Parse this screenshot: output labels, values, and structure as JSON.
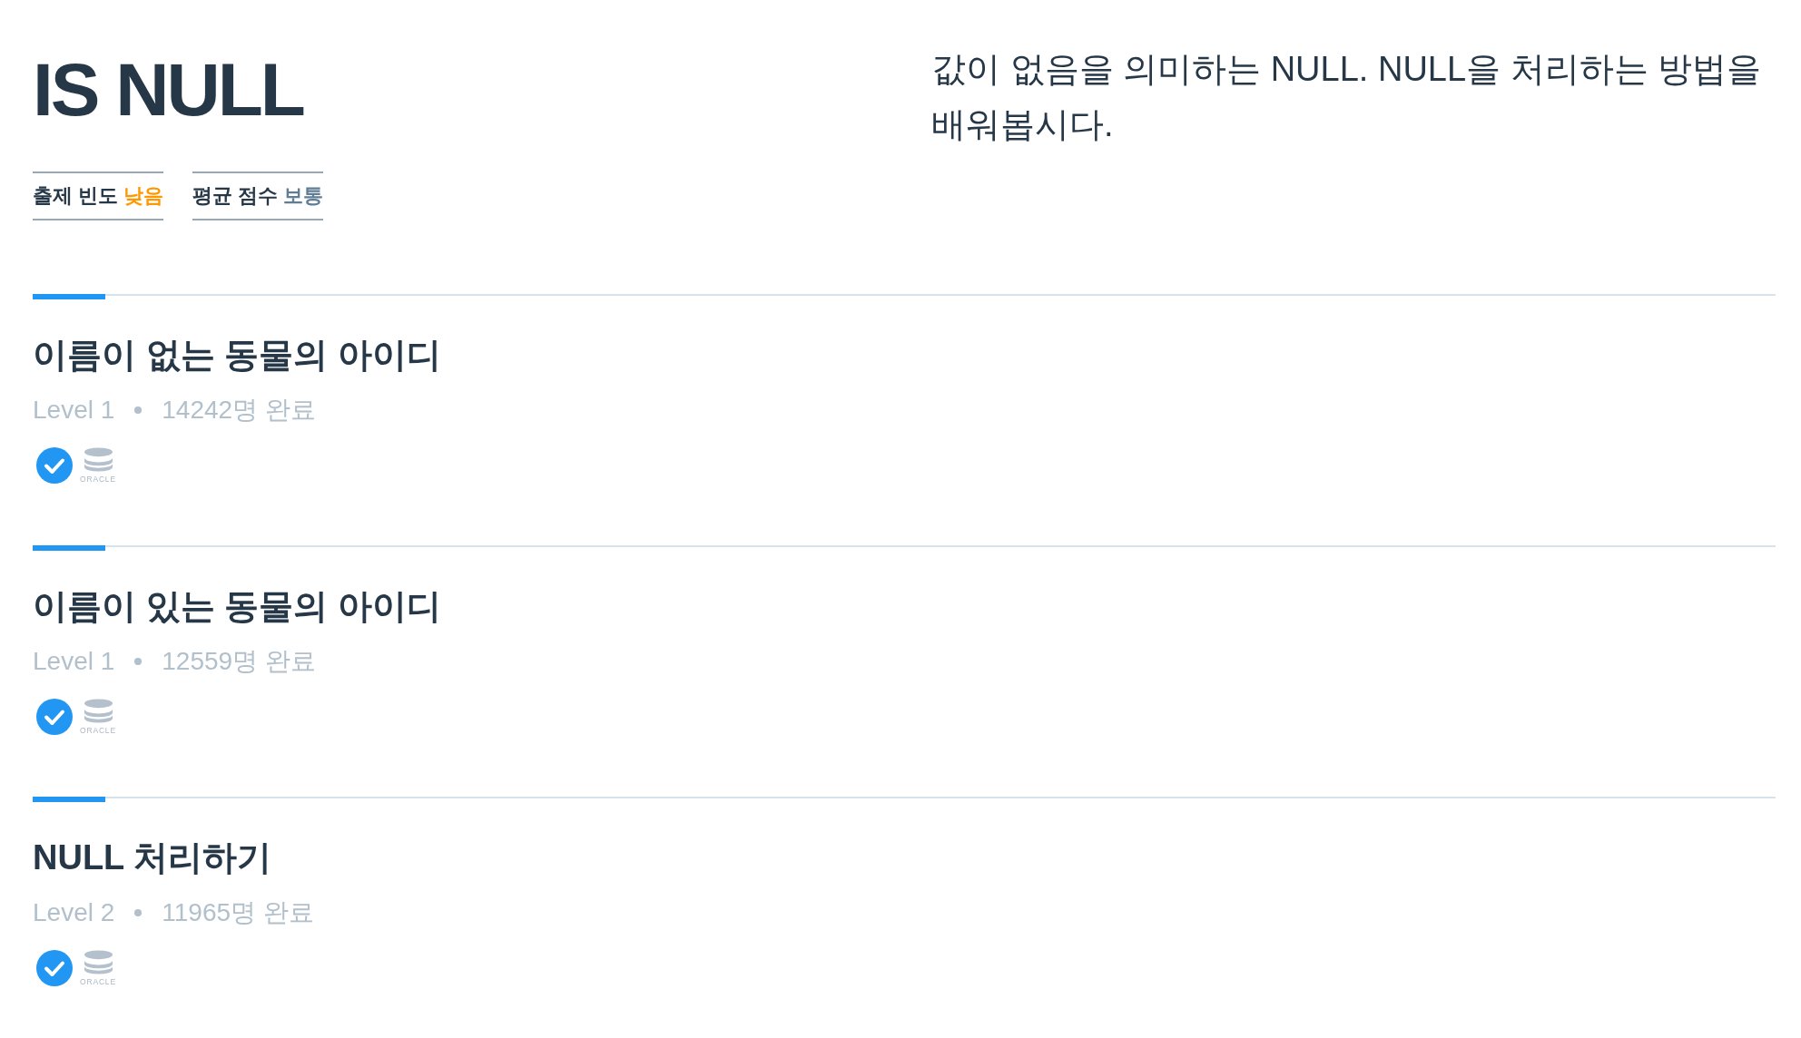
{
  "header": {
    "title": "IS NULL",
    "badges": [
      {
        "label": "출제 빈도",
        "value": "낮음",
        "color": "#ff9800"
      },
      {
        "label": "평균 점수",
        "value": "보통",
        "color": "#5f7e95"
      }
    ],
    "description": "값이 없음을 의미하는 NULL. NULL을 처리하는 방법을 배워봅시다."
  },
  "problems": [
    {
      "title": "이름이 없는 동물의 아이디",
      "level": "Level 1",
      "completed": "14242명 완료",
      "solved": true,
      "database": "ORACLE"
    },
    {
      "title": "이름이 있는 동물의 아이디",
      "level": "Level 1",
      "completed": "12559명 완료",
      "solved": true,
      "database": "ORACLE"
    },
    {
      "title": "NULL 처리하기",
      "level": "Level 2",
      "completed": "11965명 완료",
      "solved": true,
      "database": "ORACLE"
    }
  ]
}
